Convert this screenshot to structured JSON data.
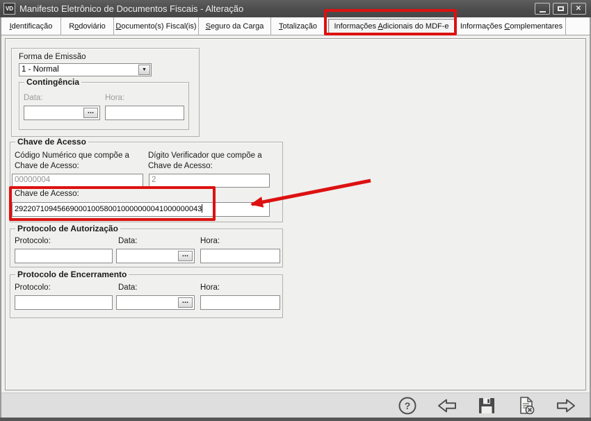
{
  "window": {
    "title": "Manifesto Eletrônico de Documentos Fiscais - Alteração",
    "icon_label": "VD",
    "controls": [
      "minimize",
      "maximize",
      "close"
    ]
  },
  "tabs": [
    {
      "pre": "",
      "key": "I",
      "post": "dentificação"
    },
    {
      "pre": "R",
      "key": "o",
      "post": "doviário"
    },
    {
      "pre": "",
      "key": "D",
      "post": "ocumento(s) Fiscal(is)"
    },
    {
      "pre": "",
      "key": "S",
      "post": "eguro da Carga"
    },
    {
      "pre": "",
      "key": "T",
      "post": "otalização"
    },
    {
      "pre": "Informações ",
      "key": "A",
      "post": "dicionais do MDF-e"
    },
    {
      "pre": "Informações ",
      "key": "C",
      "post": "omplementares"
    }
  ],
  "selected_tab_index": 5,
  "emissao": {
    "label": "Forma de Emissão",
    "value": "1 - Normal"
  },
  "contingencia": {
    "title": "Contingência",
    "data_label": "Data:",
    "hora_label": "Hora:",
    "data_value": "",
    "hora_value": ""
  },
  "chave": {
    "title": "Chave de Acesso",
    "codigo_label_line1": "Código Numérico que compõe a",
    "codigo_label_line2": "Chave de Acesso:",
    "codigo_value": "00000004",
    "digito_label_line1": "Dígito Verificador que compõe a",
    "digito_label_line2": "Chave de Acesso:",
    "chave_label": "Chave de Acesso:",
    "chave_value": "29220710945669000100580010000000041000000043",
    "digito_value": "2"
  },
  "autorizacao": {
    "title": "Protocolo de Autorização",
    "protocolo_label": "Protocolo:",
    "data_label": "Data:",
    "hora_label": "Hora:",
    "protocolo_value": "",
    "data_value": "",
    "hora_value": ""
  },
  "encerramento": {
    "title": "Protocolo de Encerramento",
    "protocolo_label": "Protocolo:",
    "data_label": "Data:",
    "hora_label": "Hora:",
    "protocolo_value": "",
    "data_value": "",
    "hora_value": ""
  },
  "ui": {
    "ellipsis_button": "...",
    "dropdown_arrow": "▼",
    "help_glyph": "?",
    "close_glyph": "✕"
  },
  "toolbar_icons": [
    "help-icon",
    "back-arrow-icon",
    "save-icon",
    "cancel-document-icon",
    "forward-arrow-icon"
  ],
  "annotations": {
    "highlight_color": "#dd1111"
  },
  "colors": {
    "titlebar": "#4d4d4d",
    "content_bg": "#f0f0ee",
    "toolbar_bg": "#dedede"
  }
}
